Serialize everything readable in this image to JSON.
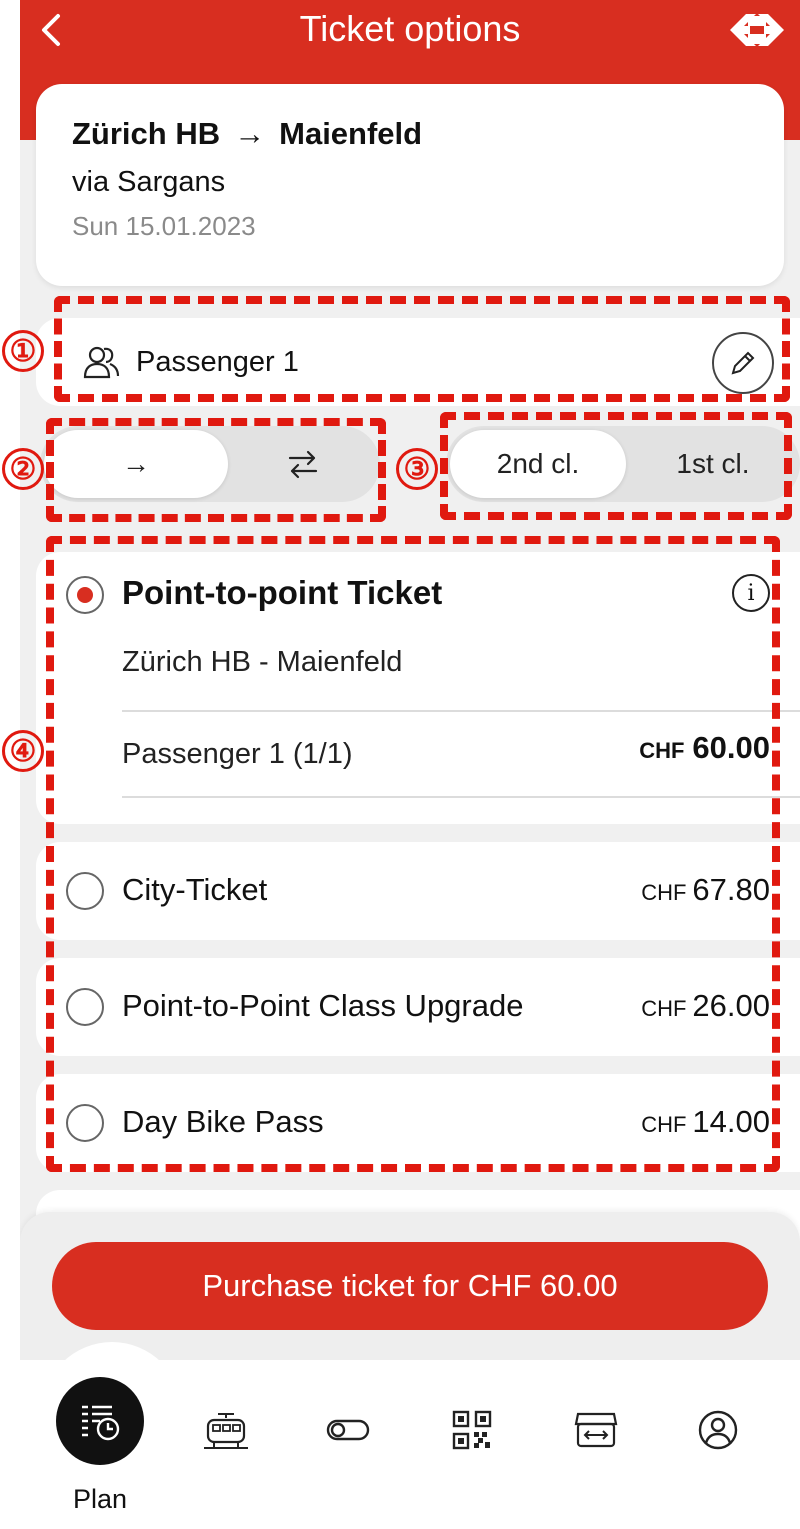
{
  "header": {
    "title": "Ticket options"
  },
  "route": {
    "from": "Zürich HB",
    "arrow": "→",
    "to": "Maienfeld",
    "via": "via Sargans",
    "date": "Sun 15.01.2023"
  },
  "passenger": {
    "label": "Passenger 1"
  },
  "direction_toggle": {
    "selected": "single",
    "options": [
      "→",
      "⇄"
    ]
  },
  "class_toggle": {
    "selected": "2nd cl.",
    "options": [
      "2nd cl.",
      "1st cl."
    ]
  },
  "tickets": {
    "main": {
      "name": "Point-to-point Ticket",
      "info_icon": "i",
      "route": "Zürich HB - Maienfeld",
      "passenger_line": "Passenger 1 (1/1)",
      "currency": "CHF",
      "price": "60.00",
      "selected": true
    },
    "options": [
      {
        "name": "City-Ticket",
        "currency": "CHF",
        "price": "67.80",
        "selected": false
      },
      {
        "name": "Point-to-Point Class Upgrade",
        "currency": "CHF",
        "price": "26.00",
        "selected": false
      },
      {
        "name": "Day Bike Pass",
        "currency": "CHF",
        "price": "14.00",
        "selected": false
      }
    ]
  },
  "purchase": {
    "label": "Purchase ticket for CHF 60.00"
  },
  "tabbar": {
    "active_label": "Plan",
    "icons": [
      "timetable-clock-icon",
      "train-icon",
      "toggle-icon",
      "qr-code-icon",
      "shop-icon",
      "profile-icon"
    ]
  },
  "annotations": [
    "①",
    "②",
    "③",
    "④"
  ],
  "colors": {
    "brand_red": "#d82e20",
    "annotation_red": "#e0190f"
  }
}
